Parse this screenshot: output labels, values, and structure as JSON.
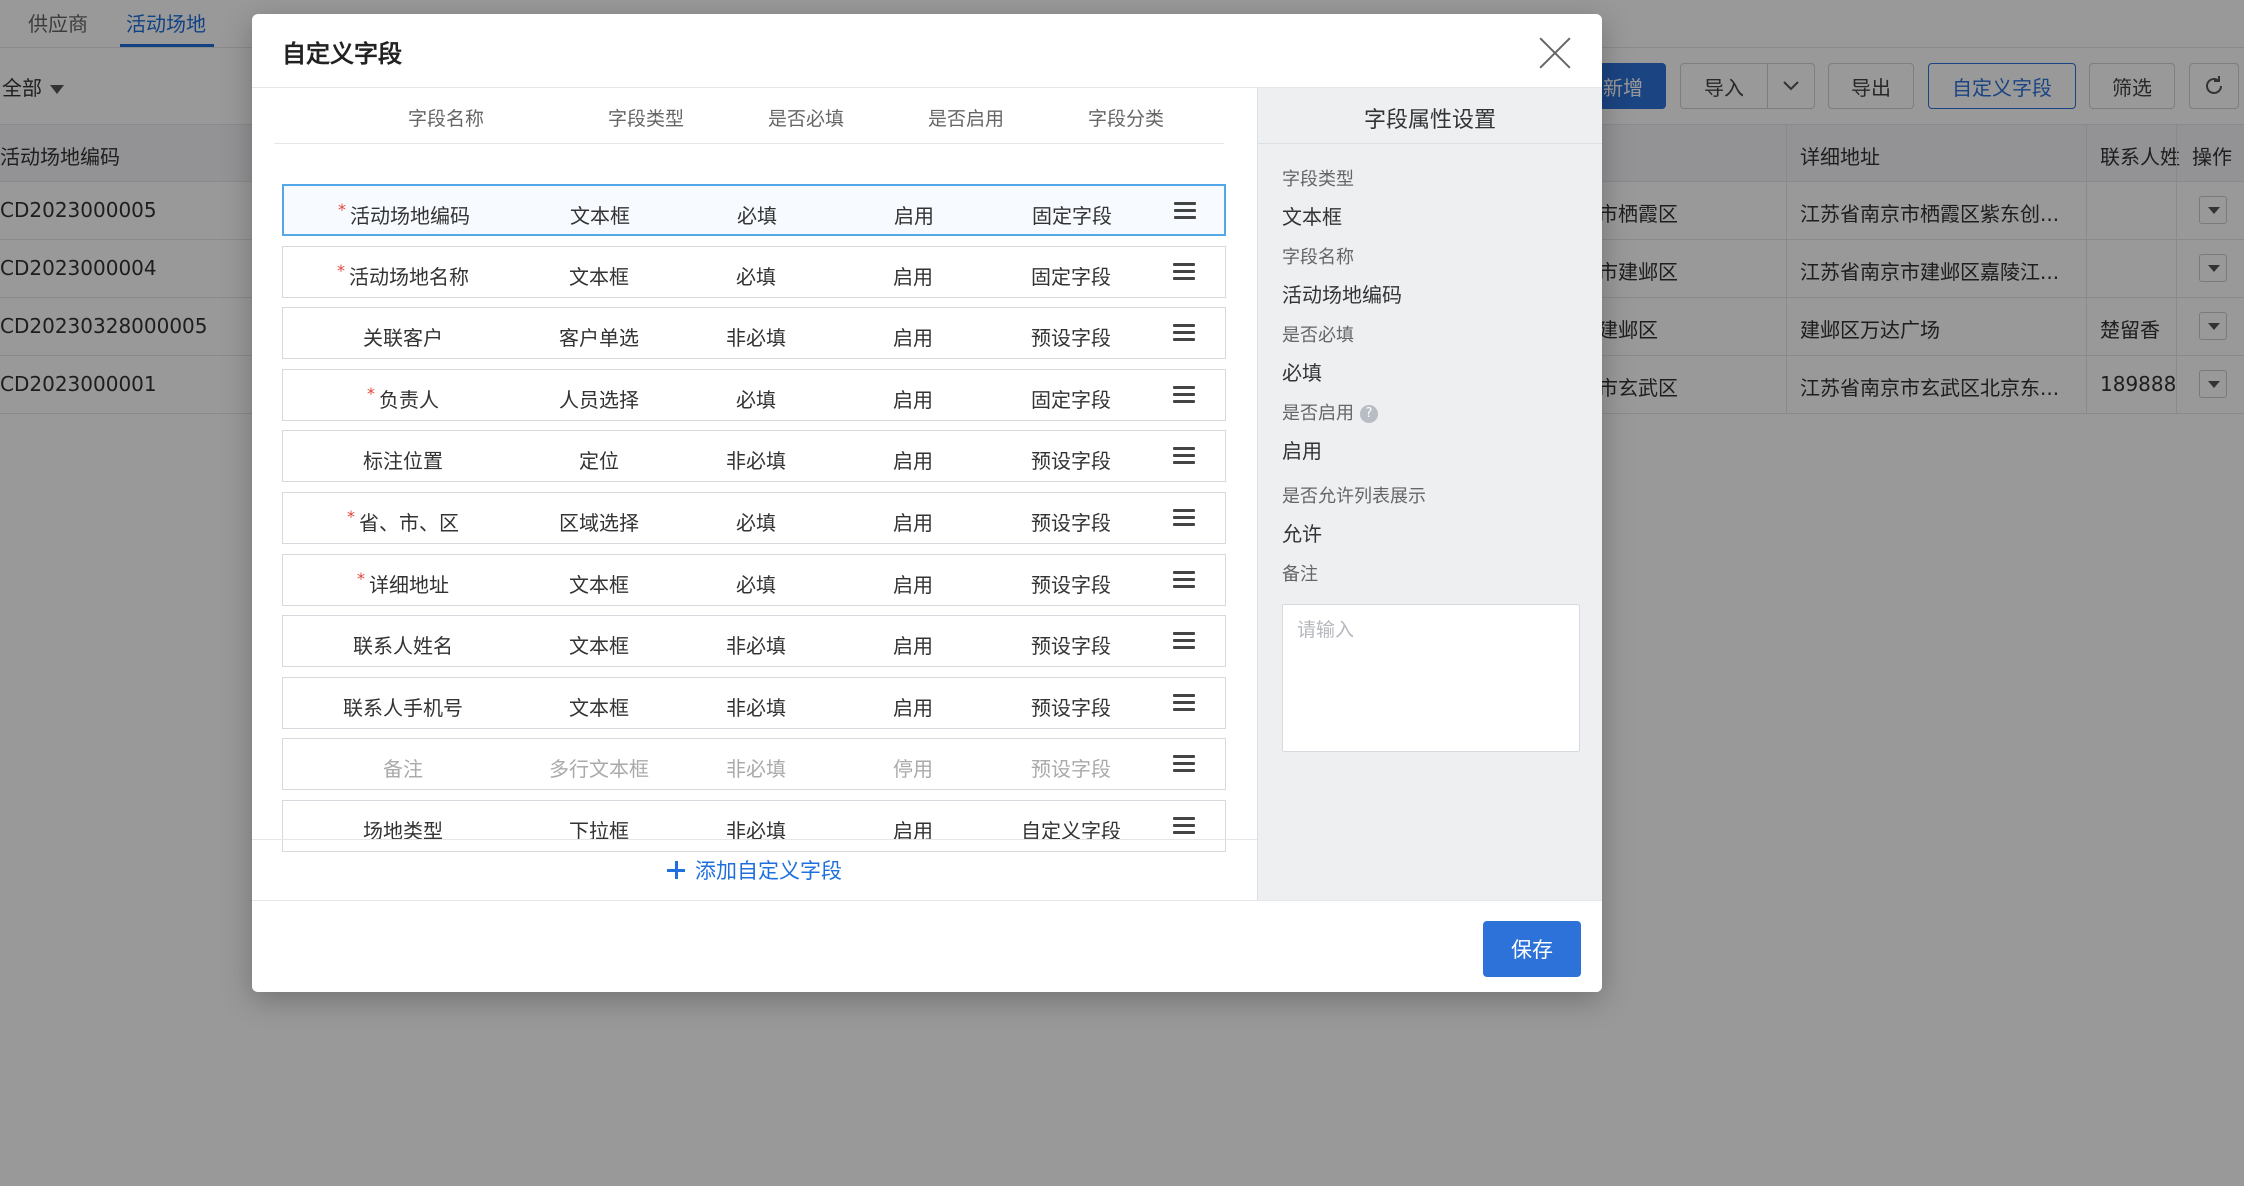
{
  "background": {
    "tabs": [
      "供应商",
      "活动场地"
    ],
    "filter": "全部",
    "toolbar": {
      "add": "新增",
      "import": "导入",
      "export": "导出",
      "custom_fields": "自定义字段",
      "filter": "筛选"
    },
    "table": {
      "columns": [
        "活动场地编码",
        "详细地址",
        "联系人姓",
        "操作"
      ],
      "rows": [
        {
          "code": "CD2023000005",
          "district": "市栖霞区",
          "address": "江苏省南京市栖霞区紫东创...",
          "contact": ""
        },
        {
          "code": "CD2023000004",
          "district": "市建邺区",
          "address": "江苏省南京市建邺区嘉陵江...",
          "contact": ""
        },
        {
          "code": "CD20230328000005",
          "district": "建邺区",
          "address": "建邺区万达广场",
          "contact": "楚留香"
        },
        {
          "code": "CD2023000001",
          "district": "市玄武区",
          "address": "江苏省南京市玄武区北京东...",
          "contact": "189888"
        }
      ]
    }
  },
  "modal": {
    "title": "自定义字段",
    "columns": [
      "字段名称",
      "字段类型",
      "是否必填",
      "是否启用",
      "字段分类"
    ],
    "fields": [
      {
        "name": "活动场地编码",
        "required_mark": true,
        "type": "文本框",
        "required": "必填",
        "enabled": "启用",
        "category": "固定字段",
        "selected": true,
        "disabled": false
      },
      {
        "name": "活动场地名称",
        "required_mark": true,
        "type": "文本框",
        "required": "必填",
        "enabled": "启用",
        "category": "固定字段",
        "selected": false,
        "disabled": false
      },
      {
        "name": "关联客户",
        "required_mark": false,
        "type": "客户单选",
        "required": "非必填",
        "enabled": "启用",
        "category": "预设字段",
        "selected": false,
        "disabled": false
      },
      {
        "name": "负责人",
        "required_mark": true,
        "type": "人员选择",
        "required": "必填",
        "enabled": "启用",
        "category": "固定字段",
        "selected": false,
        "disabled": false
      },
      {
        "name": "标注位置",
        "required_mark": false,
        "type": "定位",
        "required": "非必填",
        "enabled": "启用",
        "category": "预设字段",
        "selected": false,
        "disabled": false
      },
      {
        "name": "省、市、区",
        "required_mark": true,
        "type": "区域选择",
        "required": "必填",
        "enabled": "启用",
        "category": "预设字段",
        "selected": false,
        "disabled": false
      },
      {
        "name": "详细地址",
        "required_mark": true,
        "type": "文本框",
        "required": "必填",
        "enabled": "启用",
        "category": "预设字段",
        "selected": false,
        "disabled": false
      },
      {
        "name": "联系人姓名",
        "required_mark": false,
        "type": "文本框",
        "required": "非必填",
        "enabled": "启用",
        "category": "预设字段",
        "selected": false,
        "disabled": false
      },
      {
        "name": "联系人手机号",
        "required_mark": false,
        "type": "文本框",
        "required": "非必填",
        "enabled": "启用",
        "category": "预设字段",
        "selected": false,
        "disabled": false
      },
      {
        "name": "备注",
        "required_mark": false,
        "type": "多行文本框",
        "required": "非必填",
        "enabled": "停用",
        "category": "预设字段",
        "selected": false,
        "disabled": true
      },
      {
        "name": "场地类型",
        "required_mark": false,
        "type": "下拉框",
        "required": "非必填",
        "enabled": "启用",
        "category": "自定义字段",
        "selected": false,
        "disabled": false
      }
    ],
    "add_field_label": "添加自定义字段",
    "properties": {
      "title": "字段属性设置",
      "type_label": "字段类型",
      "type_value": "文本框",
      "name_label": "字段名称",
      "name_value": "活动场地编码",
      "required_label": "是否必填",
      "required_value": "必填",
      "enabled_label": "是否启用",
      "enabled_value": "启用",
      "list_label": "是否允许列表展示",
      "list_value": "允许",
      "remark_label": "备注",
      "remark_placeholder": "请输入"
    },
    "save_label": "保存"
  },
  "colors": {
    "primary": "#2d72d9",
    "selected_border": "#54a8e8",
    "required_star": "#e0463c"
  }
}
